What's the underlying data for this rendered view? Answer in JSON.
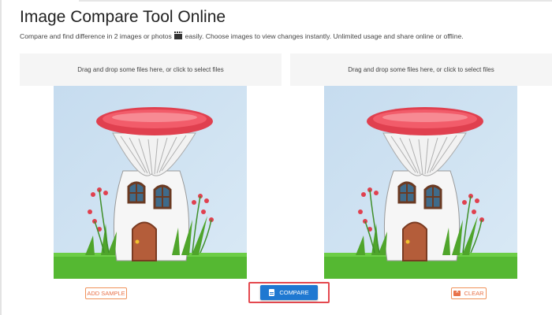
{
  "header": {
    "title": "Image Compare Tool Online",
    "subtitle_before": "Compare and find difference in 2 images or photos",
    "subtitle_after": "easily. Choose images to view changes instantly. Unlimited usage and share online or offline."
  },
  "left_panel": {
    "dropzone_text": "Drag and drop some files here, or click to select files",
    "image_subject": "fairy mushroom house illustration"
  },
  "right_panel": {
    "dropzone_text": "Drag and drop some files here, or click to select files",
    "image_subject": "fairy mushroom house illustration"
  },
  "actions": {
    "add_sample_label": "ADD SAMPLE",
    "compare_label": "COMPARE",
    "clear_label": "CLEAR"
  },
  "colors": {
    "accent_orange": "#e8734a",
    "compare_blue": "#1f78d1",
    "highlight_red": "#e4484e"
  },
  "icons": {
    "subtitle": "clapperboard-icon",
    "compare": "document-icon",
    "clear": "backspace-icon"
  }
}
